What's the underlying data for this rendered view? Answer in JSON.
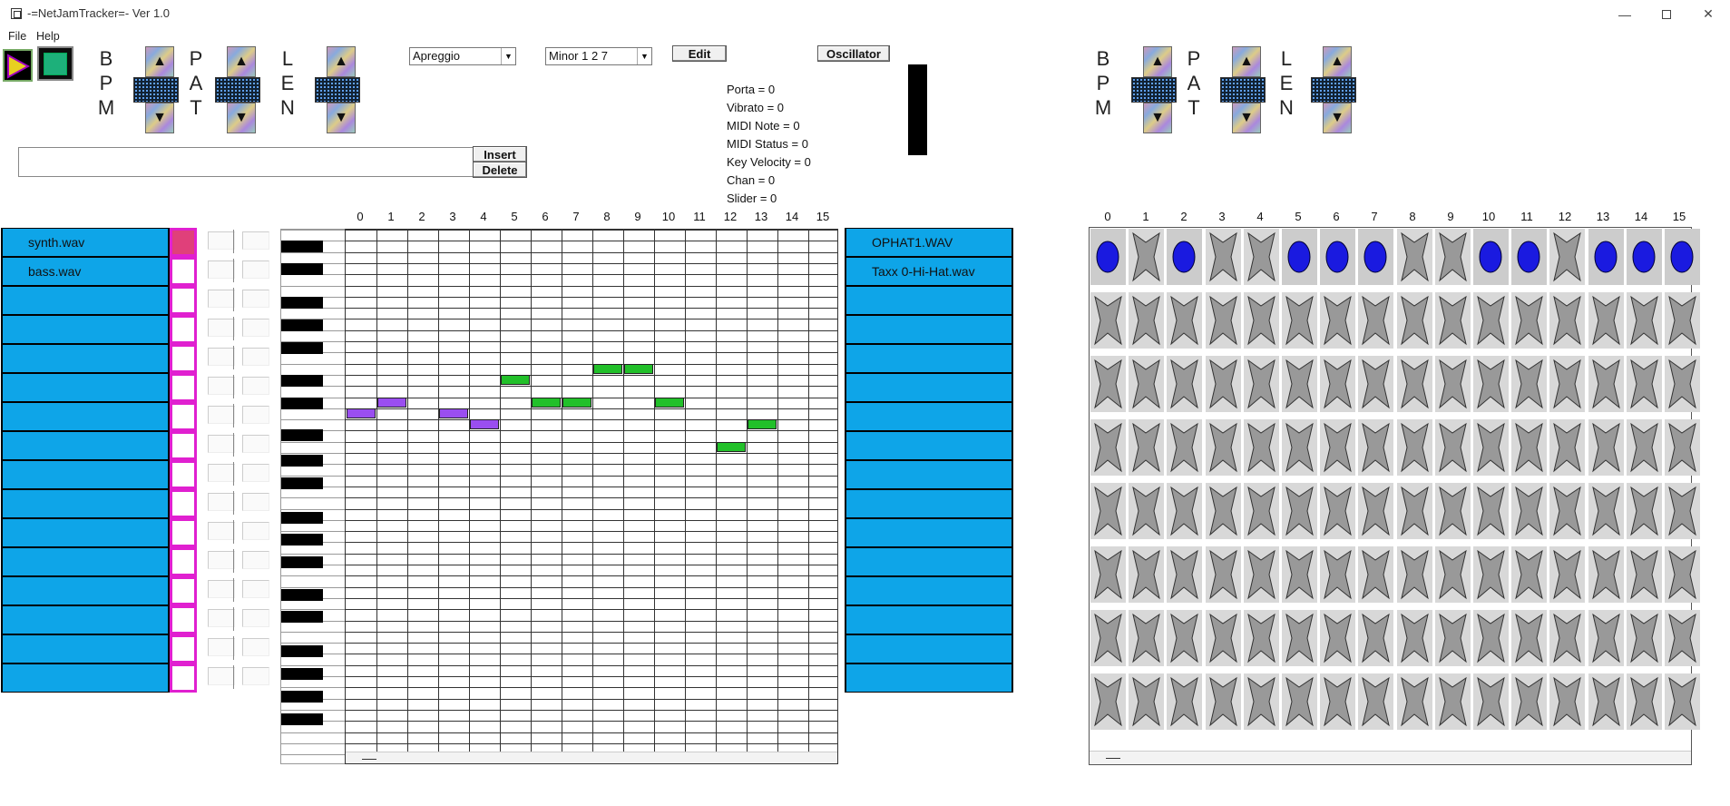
{
  "window": {
    "title": "-=NetJamTracker=- Ver 1.0"
  },
  "menu": [
    "File",
    "Help"
  ],
  "labels": {
    "bpm": [
      "B",
      "P",
      "M"
    ],
    "pat": [
      "P",
      "A",
      "T"
    ],
    "len": [
      "L",
      "E",
      "N"
    ]
  },
  "controls": {
    "mode_select": "Apreggio",
    "scale_select": "Minor 1 2 7",
    "edit_label": "Edit",
    "oscillator_label": "Oscillator",
    "insert_label": "Insert",
    "delete_label": "Delete",
    "name_input_value": ""
  },
  "status": {
    "porta": "Porta = 0",
    "vibrato": "Vibrato = 0",
    "midi_note": "MIDI Note = 0",
    "midi_status": "MIDI Status = 0",
    "key_velocity": "Key Velocity = 0",
    "chan": "Chan = 0",
    "slider": "Slider = 0"
  },
  "synth_instruments": [
    "synth.wav",
    "bass.wav",
    "",
    "",
    "",
    "",
    "",
    "",
    "",
    "",
    "",
    "",
    "",
    "",
    "",
    ""
  ],
  "drum_instruments": [
    "OPHAT1.WAV",
    "Taxx 0-Hi-Hat.wav",
    "",
    "",
    "",
    "",
    "",
    "",
    "",
    "",
    "",
    "",
    "",
    "",
    "",
    ""
  ],
  "mute_active_row": 0,
  "step_numbers": [
    "0",
    "1",
    "2",
    "3",
    "4",
    "5",
    "6",
    "7",
    "8",
    "9",
    "10",
    "11",
    "12",
    "13",
    "14",
    "15"
  ],
  "roll_notes": [
    {
      "step": 0,
      "row": 16,
      "color": "purple"
    },
    {
      "step": 1,
      "row": 15,
      "color": "purple"
    },
    {
      "step": 3,
      "row": 16,
      "color": "purple"
    },
    {
      "step": 4,
      "row": 17,
      "color": "purple"
    },
    {
      "step": 5,
      "row": 13,
      "color": "green"
    },
    {
      "step": 6,
      "row": 15,
      "color": "green"
    },
    {
      "step": 7,
      "row": 15,
      "color": "green"
    },
    {
      "step": 8,
      "row": 12,
      "color": "green"
    },
    {
      "step": 9,
      "row": 12,
      "color": "green"
    },
    {
      "step": 10,
      "row": 15,
      "color": "green"
    },
    {
      "step": 12,
      "row": 19,
      "color": "green"
    },
    {
      "step": 13,
      "row": 17,
      "color": "green"
    }
  ],
  "drum_active_row0": [
    0,
    2,
    5,
    6,
    7,
    10,
    11,
    13,
    14,
    15
  ],
  "colors": {
    "instrument_bg": "#0ea5e8",
    "mute_border": "#e020d0",
    "note_green": "#22c02a",
    "note_purple": "#9a4ef0",
    "drum_active": "#1a1ae0"
  }
}
